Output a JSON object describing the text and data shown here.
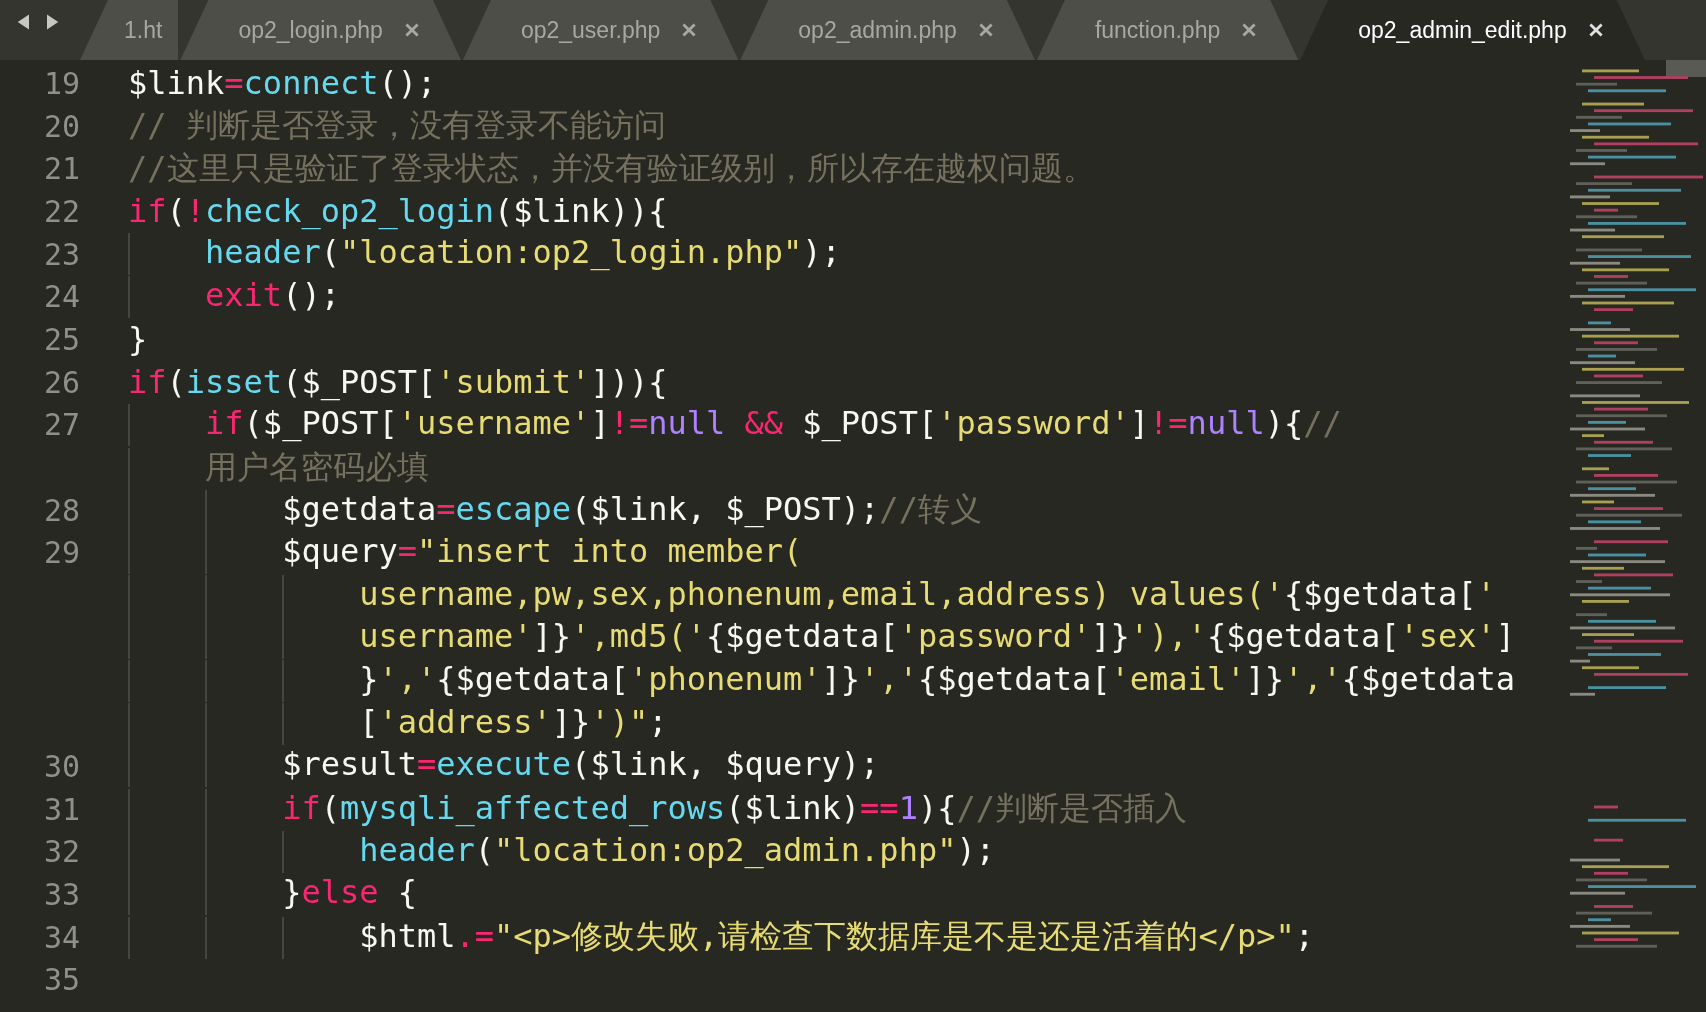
{
  "tabs": [
    {
      "label": "1.ht",
      "selected": false
    },
    {
      "label": "op2_login.php",
      "selected": false
    },
    {
      "label": "op2_user.php",
      "selected": false
    },
    {
      "label": "op2_admin.php",
      "selected": false
    },
    {
      "label": "function.php",
      "selected": false
    },
    {
      "label": "op2_admin_edit.php",
      "selected": true
    }
  ],
  "code_lines": [
    {
      "number": "19",
      "tokens": [
        {
          "kind": "variable",
          "text": "$link"
        },
        {
          "kind": "operator",
          "text": "="
        },
        {
          "kind": "function",
          "text": "connect"
        },
        {
          "kind": "plain",
          "text": "();"
        }
      ]
    },
    {
      "number": "20",
      "tokens": [
        {
          "kind": "comment",
          "text": "// 判断是否登录，没有登录不能访问"
        }
      ]
    },
    {
      "number": "21",
      "tokens": [
        {
          "kind": "comment",
          "text": "//这里只是验证了登录状态，并没有验证级别，所以存在越权问题。"
        }
      ]
    },
    {
      "number": "22",
      "tokens": [
        {
          "kind": "keyword",
          "text": "if"
        },
        {
          "kind": "plain",
          "text": "("
        },
        {
          "kind": "operator",
          "text": "!"
        },
        {
          "kind": "function",
          "text": "check_op2_login"
        },
        {
          "kind": "plain",
          "text": "($link)){"
        }
      ]
    },
    {
      "number": "23",
      "tokens": [
        {
          "kind": "indent"
        },
        {
          "kind": "function",
          "text": "header"
        },
        {
          "kind": "plain",
          "text": "("
        },
        {
          "kind": "string",
          "text": "\"location:op2_login.php\""
        },
        {
          "kind": "plain",
          "text": ");"
        }
      ]
    },
    {
      "number": "24",
      "tokens": [
        {
          "kind": "indent"
        },
        {
          "kind": "keyword",
          "text": "exit"
        },
        {
          "kind": "plain",
          "text": "();"
        }
      ]
    },
    {
      "number": "25",
      "tokens": [
        {
          "kind": "plain",
          "text": "}"
        }
      ]
    },
    {
      "number": "26",
      "tokens": [
        {
          "kind": "keyword",
          "text": "if"
        },
        {
          "kind": "plain",
          "text": "("
        },
        {
          "kind": "function",
          "text": "isset"
        },
        {
          "kind": "plain",
          "text": "($_POST["
        },
        {
          "kind": "string",
          "text": "'submit'"
        },
        {
          "kind": "plain",
          "text": "])){"
        }
      ]
    },
    {
      "number": "27",
      "tokens": [
        {
          "kind": "indent"
        },
        {
          "kind": "keyword",
          "text": "if"
        },
        {
          "kind": "plain",
          "text": "($_POST["
        },
        {
          "kind": "string",
          "text": "'username'"
        },
        {
          "kind": "plain",
          "text": "]"
        },
        {
          "kind": "operator",
          "text": "!="
        },
        {
          "kind": "constant",
          "text": "null"
        },
        {
          "kind": "operator",
          "text": " &&"
        },
        {
          "kind": "plain",
          "text": " $_POST["
        },
        {
          "kind": "string",
          "text": "'password'"
        },
        {
          "kind": "plain",
          "text": "]"
        },
        {
          "kind": "operator",
          "text": "!="
        },
        {
          "kind": "constant",
          "text": "null"
        },
        {
          "kind": "plain",
          "text": "){"
        },
        {
          "kind": "comment",
          "text": "//"
        }
      ]
    },
    {
      "tokens": [
        {
          "kind": "indent"
        },
        {
          "kind": "comment",
          "text": "用户名密码必填"
        }
      ]
    },
    {
      "number": "28",
      "tokens": [
        {
          "kind": "indent"
        },
        {
          "kind": "indent"
        },
        {
          "kind": "variable",
          "text": "$getdata"
        },
        {
          "kind": "operator",
          "text": "="
        },
        {
          "kind": "function",
          "text": "escape"
        },
        {
          "kind": "plain",
          "text": "($link, $_POST);"
        },
        {
          "kind": "comment",
          "text": "//转义"
        }
      ]
    },
    {
      "number": "29",
      "tokens": [
        {
          "kind": "indent"
        },
        {
          "kind": "indent"
        },
        {
          "kind": "variable",
          "text": "$query"
        },
        {
          "kind": "operator",
          "text": "="
        },
        {
          "kind": "string",
          "text": "\"insert into member("
        }
      ]
    },
    {
      "tokens": [
        {
          "kind": "indent"
        },
        {
          "kind": "indent"
        },
        {
          "kind": "indent"
        },
        {
          "kind": "string",
          "text": "username,pw,sex,phonenum,email,address) values('"
        },
        {
          "kind": "plain",
          "text": "{$getdata["
        },
        {
          "kind": "string",
          "text": "'"
        }
      ]
    },
    {
      "tokens": [
        {
          "kind": "indent"
        },
        {
          "kind": "indent"
        },
        {
          "kind": "indent"
        },
        {
          "kind": "string",
          "text": "username'"
        },
        {
          "kind": "plain",
          "text": "]}"
        },
        {
          "kind": "string",
          "text": "',md5('"
        },
        {
          "kind": "plain",
          "text": "{$getdata["
        },
        {
          "kind": "string",
          "text": "'password'"
        },
        {
          "kind": "plain",
          "text": "]}"
        },
        {
          "kind": "string",
          "text": "'),'"
        },
        {
          "kind": "plain",
          "text": "{$getdata["
        },
        {
          "kind": "string",
          "text": "'sex'"
        },
        {
          "kind": "plain",
          "text": "]"
        }
      ]
    },
    {
      "tokens": [
        {
          "kind": "indent"
        },
        {
          "kind": "indent"
        },
        {
          "kind": "indent"
        },
        {
          "kind": "plain",
          "text": "}"
        },
        {
          "kind": "string",
          "text": "','"
        },
        {
          "kind": "plain",
          "text": "{$getdata["
        },
        {
          "kind": "string",
          "text": "'phonenum'"
        },
        {
          "kind": "plain",
          "text": "]}"
        },
        {
          "kind": "string",
          "text": "','"
        },
        {
          "kind": "plain",
          "text": "{$getdata["
        },
        {
          "kind": "string",
          "text": "'email'"
        },
        {
          "kind": "plain",
          "text": "]}"
        },
        {
          "kind": "string",
          "text": "','"
        },
        {
          "kind": "plain",
          "text": "{$getdata"
        }
      ]
    },
    {
      "tokens": [
        {
          "kind": "indent"
        },
        {
          "kind": "indent"
        },
        {
          "kind": "indent"
        },
        {
          "kind": "plain",
          "text": "["
        },
        {
          "kind": "string",
          "text": "'address'"
        },
        {
          "kind": "plain",
          "text": "]}"
        },
        {
          "kind": "string",
          "text": "')\""
        },
        {
          "kind": "plain",
          "text": ";"
        }
      ]
    },
    {
      "number": "30",
      "tokens": [
        {
          "kind": "indent"
        },
        {
          "kind": "indent"
        },
        {
          "kind": "variable",
          "text": "$result"
        },
        {
          "kind": "operator",
          "text": "="
        },
        {
          "kind": "function",
          "text": "execute"
        },
        {
          "kind": "plain",
          "text": "($link, $query);"
        }
      ]
    },
    {
      "number": "31",
      "tokens": [
        {
          "kind": "indent"
        },
        {
          "kind": "indent"
        },
        {
          "kind": "keyword",
          "text": "if"
        },
        {
          "kind": "plain",
          "text": "("
        },
        {
          "kind": "function",
          "text": "mysqli_affected_rows"
        },
        {
          "kind": "plain",
          "text": "($link)"
        },
        {
          "kind": "operator",
          "text": "=="
        },
        {
          "kind": "constant",
          "text": "1"
        },
        {
          "kind": "plain",
          "text": "){"
        },
        {
          "kind": "comment",
          "text": "//判断是否插入"
        }
      ]
    },
    {
      "number": "32",
      "tokens": [
        {
          "kind": "indent"
        },
        {
          "kind": "indent"
        },
        {
          "kind": "indent"
        },
        {
          "kind": "function",
          "text": "header"
        },
        {
          "kind": "plain",
          "text": "("
        },
        {
          "kind": "string",
          "text": "\"location:op2_admin.php\""
        },
        {
          "kind": "plain",
          "text": ");"
        }
      ]
    },
    {
      "number": "33",
      "tokens": [
        {
          "kind": "indent"
        },
        {
          "kind": "indent"
        },
        {
          "kind": "plain",
          "text": "}"
        },
        {
          "kind": "keyword",
          "text": "else"
        },
        {
          "kind": "plain",
          "text": " {"
        }
      ]
    },
    {
      "number": "34",
      "tokens": [
        {
          "kind": "indent"
        },
        {
          "kind": "indent"
        },
        {
          "kind": "indent"
        },
        {
          "kind": "variable",
          "text": "$html"
        },
        {
          "kind": "operator",
          "text": ".="
        },
        {
          "kind": "string",
          "text": "\"<p>修改失败,请检查下数据库是不是还是活着的</p>\""
        },
        {
          "kind": "plain",
          "text": ";"
        }
      ]
    },
    {
      "number": "35"
    }
  ]
}
